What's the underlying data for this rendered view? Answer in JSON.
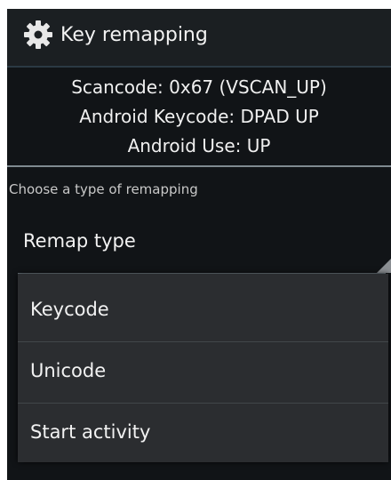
{
  "app": {
    "title": "Key remapping",
    "title_icon": "gear-icon"
  },
  "key_info": {
    "scancode": "Scancode: 0x67 (VSCAN_UP)",
    "android_keycode": "Android Keycode: DPAD UP",
    "android_use": "Android Use: UP"
  },
  "remap": {
    "prompt": "Choose a type of remapping",
    "field_label": "Remap type",
    "options": [
      {
        "label": "Keycode"
      },
      {
        "label": "Unicode"
      },
      {
        "label": "Start activity"
      }
    ]
  },
  "colors": {
    "background": "#111417",
    "titlebar": "#1b1f22",
    "popup": "#2b2d30",
    "text": "#f2f2f2"
  }
}
